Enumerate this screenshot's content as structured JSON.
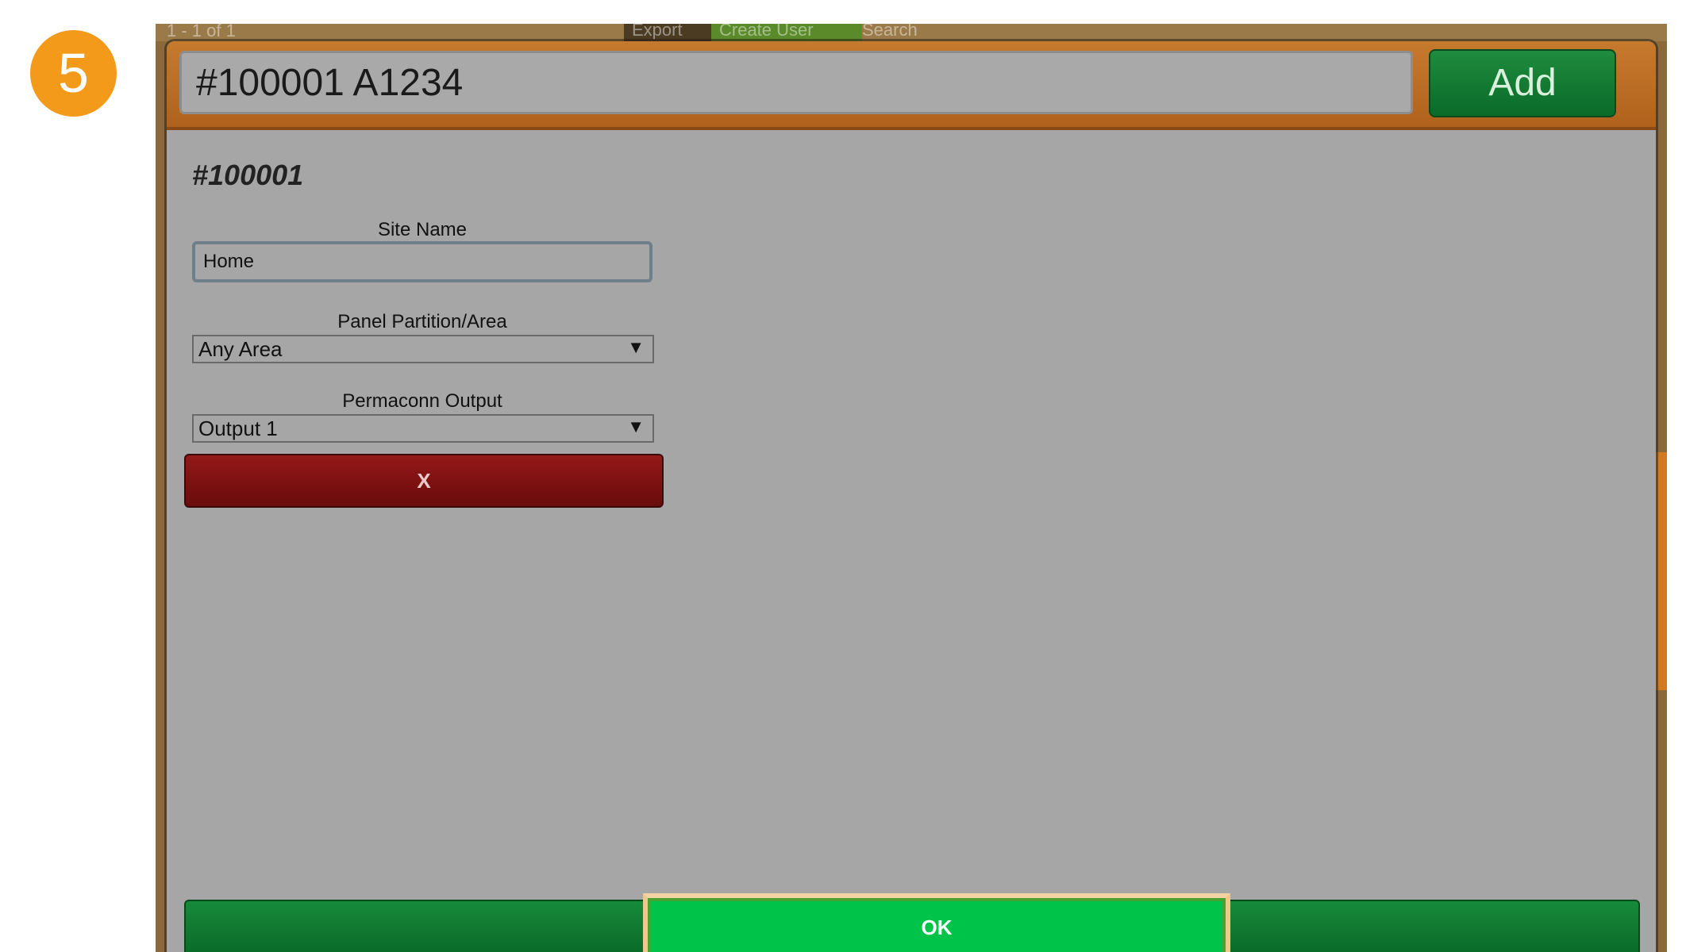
{
  "step_badge": "5",
  "background": {
    "pagination": "1 - 1 of 1",
    "export_label": "Export",
    "create_user_label": "Create User",
    "search_label": "Search"
  },
  "dialog": {
    "search_value": "#100001 A1234",
    "add_label": "Add",
    "section_title": "#100001",
    "site_name_label": "Site Name",
    "site_name_value": "Home",
    "partition_label": "Panel Partition/Area",
    "partition_value": "Any Area",
    "output_label": "Permaconn Output",
    "output_value": "Output 1",
    "remove_label": "X",
    "ok_label": "OK"
  },
  "colors": {
    "header_orange": "#c67a2e",
    "dialog_gray": "#a6a6a6",
    "add_green": "#1f8c3e",
    "remove_red": "#951818",
    "ok_green": "#00c44a",
    "badge_orange": "#f39a1a"
  },
  "icons": {
    "select_arrow": "triangle-down-icon"
  }
}
